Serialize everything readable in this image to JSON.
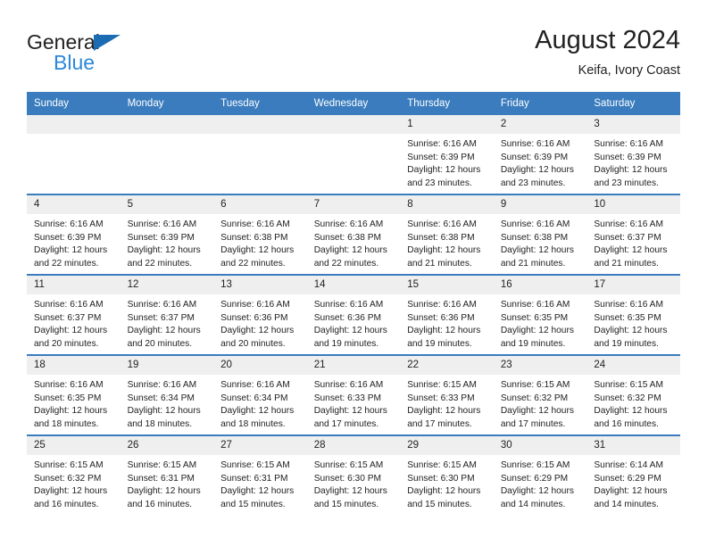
{
  "brand": {
    "name_top": "General",
    "name_bottom": "Blue",
    "triangle_color": "#1b6cb3",
    "blue_color": "#2b88d8"
  },
  "header": {
    "title": "August 2024",
    "subtitle": "Keifa, Ivory Coast"
  },
  "theme": {
    "header_bg": "#3a7cbe",
    "daynum_bg": "#efefef",
    "text": "#222222"
  },
  "weekday_headers": [
    "Sunday",
    "Monday",
    "Tuesday",
    "Wednesday",
    "Thursday",
    "Friday",
    "Saturday"
  ],
  "labels": {
    "sunrise_prefix": "Sunrise: ",
    "sunset_prefix": "Sunset: ",
    "daylight_prefix": "Daylight: "
  },
  "weeks": [
    [
      {
        "day": "",
        "empty": true
      },
      {
        "day": "",
        "empty": true
      },
      {
        "day": "",
        "empty": true
      },
      {
        "day": "",
        "empty": true
      },
      {
        "day": "1",
        "sunrise": "Sunrise: 6:16 AM",
        "sunset": "Sunset: 6:39 PM",
        "daylight": "Daylight: 12 hours and 23 minutes."
      },
      {
        "day": "2",
        "sunrise": "Sunrise: 6:16 AM",
        "sunset": "Sunset: 6:39 PM",
        "daylight": "Daylight: 12 hours and 23 minutes."
      },
      {
        "day": "3",
        "sunrise": "Sunrise: 6:16 AM",
        "sunset": "Sunset: 6:39 PM",
        "daylight": "Daylight: 12 hours and 23 minutes."
      }
    ],
    [
      {
        "day": "4",
        "sunrise": "Sunrise: 6:16 AM",
        "sunset": "Sunset: 6:39 PM",
        "daylight": "Daylight: 12 hours and 22 minutes."
      },
      {
        "day": "5",
        "sunrise": "Sunrise: 6:16 AM",
        "sunset": "Sunset: 6:39 PM",
        "daylight": "Daylight: 12 hours and 22 minutes."
      },
      {
        "day": "6",
        "sunrise": "Sunrise: 6:16 AM",
        "sunset": "Sunset: 6:38 PM",
        "daylight": "Daylight: 12 hours and 22 minutes."
      },
      {
        "day": "7",
        "sunrise": "Sunrise: 6:16 AM",
        "sunset": "Sunset: 6:38 PM",
        "daylight": "Daylight: 12 hours and 22 minutes."
      },
      {
        "day": "8",
        "sunrise": "Sunrise: 6:16 AM",
        "sunset": "Sunset: 6:38 PM",
        "daylight": "Daylight: 12 hours and 21 minutes."
      },
      {
        "day": "9",
        "sunrise": "Sunrise: 6:16 AM",
        "sunset": "Sunset: 6:38 PM",
        "daylight": "Daylight: 12 hours and 21 minutes."
      },
      {
        "day": "10",
        "sunrise": "Sunrise: 6:16 AM",
        "sunset": "Sunset: 6:37 PM",
        "daylight": "Daylight: 12 hours and 21 minutes."
      }
    ],
    [
      {
        "day": "11",
        "sunrise": "Sunrise: 6:16 AM",
        "sunset": "Sunset: 6:37 PM",
        "daylight": "Daylight: 12 hours and 20 minutes."
      },
      {
        "day": "12",
        "sunrise": "Sunrise: 6:16 AM",
        "sunset": "Sunset: 6:37 PM",
        "daylight": "Daylight: 12 hours and 20 minutes."
      },
      {
        "day": "13",
        "sunrise": "Sunrise: 6:16 AM",
        "sunset": "Sunset: 6:36 PM",
        "daylight": "Daylight: 12 hours and 20 minutes."
      },
      {
        "day": "14",
        "sunrise": "Sunrise: 6:16 AM",
        "sunset": "Sunset: 6:36 PM",
        "daylight": "Daylight: 12 hours and 19 minutes."
      },
      {
        "day": "15",
        "sunrise": "Sunrise: 6:16 AM",
        "sunset": "Sunset: 6:36 PM",
        "daylight": "Daylight: 12 hours and 19 minutes."
      },
      {
        "day": "16",
        "sunrise": "Sunrise: 6:16 AM",
        "sunset": "Sunset: 6:35 PM",
        "daylight": "Daylight: 12 hours and 19 minutes."
      },
      {
        "day": "17",
        "sunrise": "Sunrise: 6:16 AM",
        "sunset": "Sunset: 6:35 PM",
        "daylight": "Daylight: 12 hours and 19 minutes."
      }
    ],
    [
      {
        "day": "18",
        "sunrise": "Sunrise: 6:16 AM",
        "sunset": "Sunset: 6:35 PM",
        "daylight": "Daylight: 12 hours and 18 minutes."
      },
      {
        "day": "19",
        "sunrise": "Sunrise: 6:16 AM",
        "sunset": "Sunset: 6:34 PM",
        "daylight": "Daylight: 12 hours and 18 minutes."
      },
      {
        "day": "20",
        "sunrise": "Sunrise: 6:16 AM",
        "sunset": "Sunset: 6:34 PM",
        "daylight": "Daylight: 12 hours and 18 minutes."
      },
      {
        "day": "21",
        "sunrise": "Sunrise: 6:16 AM",
        "sunset": "Sunset: 6:33 PM",
        "daylight": "Daylight: 12 hours and 17 minutes."
      },
      {
        "day": "22",
        "sunrise": "Sunrise: 6:15 AM",
        "sunset": "Sunset: 6:33 PM",
        "daylight": "Daylight: 12 hours and 17 minutes."
      },
      {
        "day": "23",
        "sunrise": "Sunrise: 6:15 AM",
        "sunset": "Sunset: 6:32 PM",
        "daylight": "Daylight: 12 hours and 17 minutes."
      },
      {
        "day": "24",
        "sunrise": "Sunrise: 6:15 AM",
        "sunset": "Sunset: 6:32 PM",
        "daylight": "Daylight: 12 hours and 16 minutes."
      }
    ],
    [
      {
        "day": "25",
        "sunrise": "Sunrise: 6:15 AM",
        "sunset": "Sunset: 6:32 PM",
        "daylight": "Daylight: 12 hours and 16 minutes."
      },
      {
        "day": "26",
        "sunrise": "Sunrise: 6:15 AM",
        "sunset": "Sunset: 6:31 PM",
        "daylight": "Daylight: 12 hours and 16 minutes."
      },
      {
        "day": "27",
        "sunrise": "Sunrise: 6:15 AM",
        "sunset": "Sunset: 6:31 PM",
        "daylight": "Daylight: 12 hours and 15 minutes."
      },
      {
        "day": "28",
        "sunrise": "Sunrise: 6:15 AM",
        "sunset": "Sunset: 6:30 PM",
        "daylight": "Daylight: 12 hours and 15 minutes."
      },
      {
        "day": "29",
        "sunrise": "Sunrise: 6:15 AM",
        "sunset": "Sunset: 6:30 PM",
        "daylight": "Daylight: 12 hours and 15 minutes."
      },
      {
        "day": "30",
        "sunrise": "Sunrise: 6:15 AM",
        "sunset": "Sunset: 6:29 PM",
        "daylight": "Daylight: 12 hours and 14 minutes."
      },
      {
        "day": "31",
        "sunrise": "Sunrise: 6:14 AM",
        "sunset": "Sunset: 6:29 PM",
        "daylight": "Daylight: 12 hours and 14 minutes."
      }
    ]
  ]
}
